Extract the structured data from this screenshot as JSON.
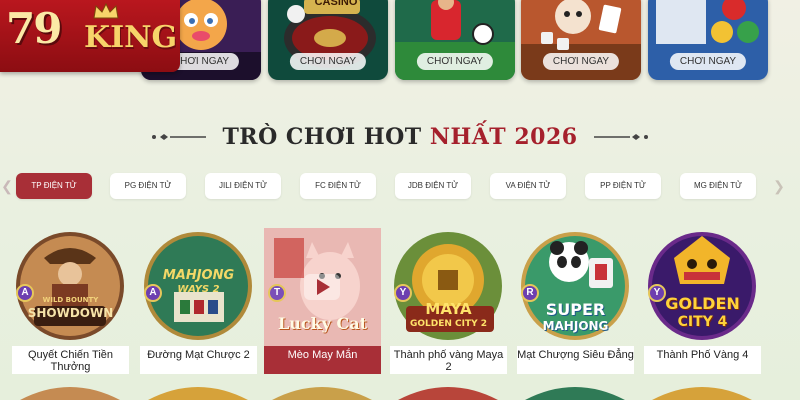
{
  "logo": {
    "number": "79",
    "word": "KING"
  },
  "top_cards": [
    {
      "play_label": "CHƠI NGAY",
      "art_text": ""
    },
    {
      "play_label": "CHƠI NGAY",
      "art_text": "CASINO"
    },
    {
      "play_label": "CHƠI NGAY",
      "art_text": ""
    },
    {
      "play_label": "CHƠI NGAY",
      "art_text": ""
    },
    {
      "play_label": "CHƠI NGAY",
      "art_text": ""
    }
  ],
  "heading": {
    "main": "TRÒ CHƠI HOT",
    "accent": "NHẤT 2026"
  },
  "tabs": [
    "TP ĐIỆN TỬ",
    "PG ĐIỆN TỬ",
    "JILI ĐIỆN TỬ",
    "FC ĐIỆN TỬ",
    "JDB ĐIỆN TỬ",
    "VA ĐIỆN TỬ",
    "PP ĐIỆN TỬ",
    "MG ĐIỆN TỬ"
  ],
  "active_tab": "TP ĐIỆN TỬ",
  "games": [
    {
      "title": "Quyết Chiến Tiền Thưởng",
      "badge": "A",
      "art_text": "SHOWDOWN",
      "art_sub": "WILD BOUNTY"
    },
    {
      "title": "Đường Mạt Chược 2",
      "badge": "A",
      "art_text": "MAHJONG",
      "art_sub": "WAYS 2"
    },
    {
      "title": "Mèo May Mắn",
      "badge": "T",
      "art_text": "Lucky Cat",
      "art_sub": ""
    },
    {
      "title": "Thành phố vàng Maya 2",
      "badge": "Y",
      "art_text": "MAYA",
      "art_sub": "GOLDEN CITY 2"
    },
    {
      "title": "Mạt Chượng Siêu Đẳng",
      "badge": "R",
      "art_text": "SUPER",
      "art_sub": "MAHJONG"
    },
    {
      "title": "Thành Phố Vàng 4",
      "badge": "Y",
      "art_text": "GOLDEN",
      "art_sub": "CITY 4"
    }
  ],
  "selected_game": "Mèo May Mắn",
  "colors": {
    "accent": "#a82f37",
    "brand_red": "#b9171e",
    "gold": "#f7d46a"
  },
  "icons": {
    "prev": "chevron-left-icon",
    "next": "chevron-right-icon",
    "play": "play-icon"
  }
}
